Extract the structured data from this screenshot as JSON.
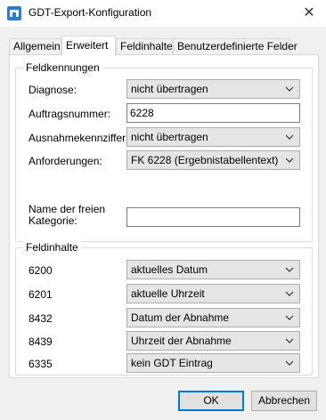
{
  "window": {
    "title": "GDT-Export-Konfiguration",
    "close_glyph": "✕",
    "app_icon": "app-window-icon"
  },
  "tabs": [
    {
      "label": "Allgemein"
    },
    {
      "label": "Erweitert",
      "active": true
    },
    {
      "label": "Feldinhalte"
    },
    {
      "label": "Benutzerdefinierte Felder"
    }
  ],
  "feldkennungen": {
    "title": "Feldkennungen",
    "diagnose": {
      "label": "Diagnose:",
      "value": "nicht übertragen"
    },
    "auftragsnummer": {
      "label": "Auftragsnummer:",
      "value": "6228"
    },
    "ausnahme": {
      "label": "Ausnahmekennziffer:",
      "value": "nicht übertragen"
    },
    "anforderungen": {
      "label": "Anforderungen:",
      "value": "FK 6228 (Ergebnistabellentext)"
    },
    "freie_kategorie": {
      "label_line1": "Name der freien",
      "label_line2": "Kategorie:",
      "value": ""
    }
  },
  "feldinhalte": {
    "title": "Feldinhalte",
    "rows": [
      {
        "code": "6200",
        "value": "aktuelles Datum"
      },
      {
        "code": "6201",
        "value": "aktuelle Uhrzeit"
      },
      {
        "code": "8432",
        "value": "Datum der Abnahme"
      },
      {
        "code": "8439",
        "value": "Uhrzeit der Abnahme"
      },
      {
        "code": "6335",
        "value": "kein GDT Eintrag"
      }
    ]
  },
  "buttons": {
    "ok": "OK",
    "cancel": "Abbrechen"
  },
  "colors": {
    "accent": "#0078d7",
    "panel_bg": "#ffffff",
    "dialog_bg": "#f0f0f0"
  }
}
